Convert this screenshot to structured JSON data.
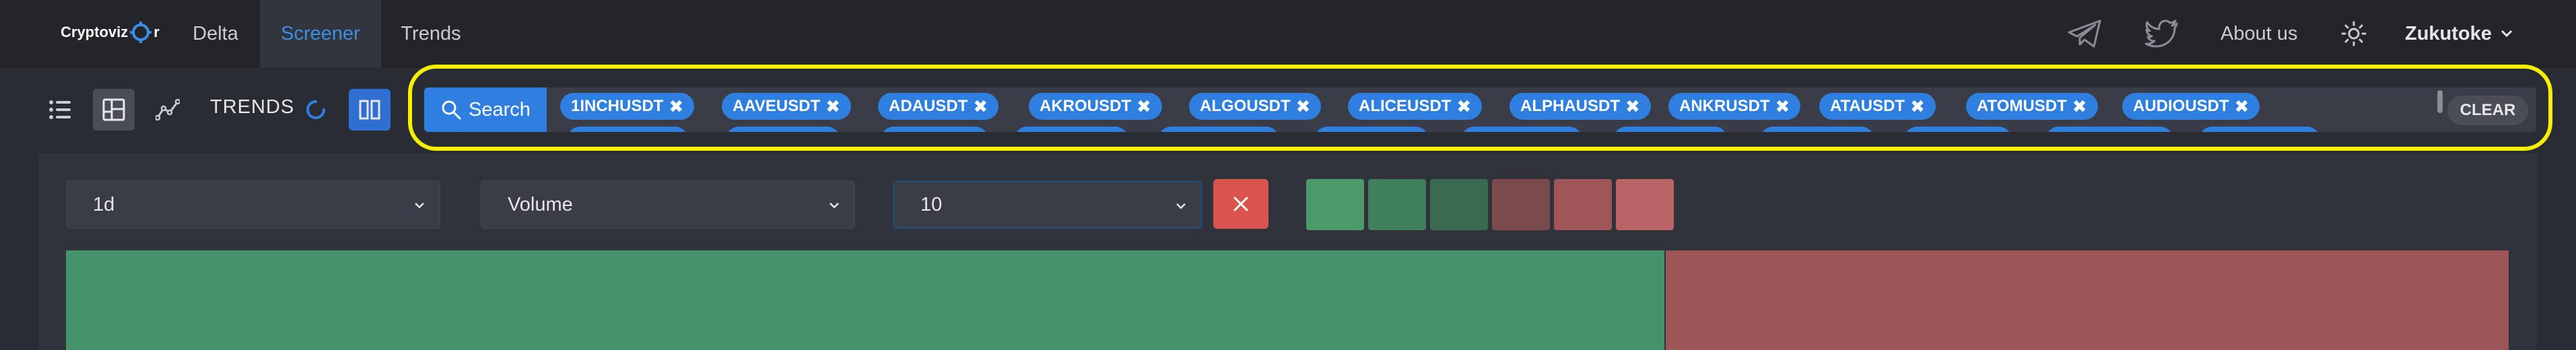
{
  "navbar": {
    "logo_left": "Cryptoviz",
    "logo_right": "r",
    "tabs": [
      {
        "label": "Delta",
        "active": false
      },
      {
        "label": "Screener",
        "active": true
      },
      {
        "label": "Trends",
        "active": false
      }
    ],
    "about": "About us",
    "user": "Zukutoke"
  },
  "toolbar": {
    "trends_label": "TRENDS"
  },
  "search": {
    "button_label": "Search",
    "clear_label": "CLEAR",
    "chips": [
      "1INCHUSDT",
      "AAVEUSDT",
      "ADAUSDT",
      "AKROUSDT",
      "ALGOUSDT",
      "ALICEUSDT",
      "ALPHAUSDT",
      "ANKRUSDT",
      "ATAUSDT",
      "ATOMUSDT",
      "AUDIOUSDT"
    ]
  },
  "filters": {
    "interval": "1d",
    "metric": "Volume",
    "count": "10"
  },
  "colors": {
    "accent": "#2f7fe0",
    "highlight": "#f4f000",
    "green_1": "#4a9a6a",
    "green_2": "#3f7f5c",
    "green_3": "#3a6b52",
    "red_1": "#7a4a4d",
    "red_2": "#a05658",
    "red_3": "#b96466",
    "heat_green": "#45936a",
    "heat_red": "#9c5658"
  }
}
